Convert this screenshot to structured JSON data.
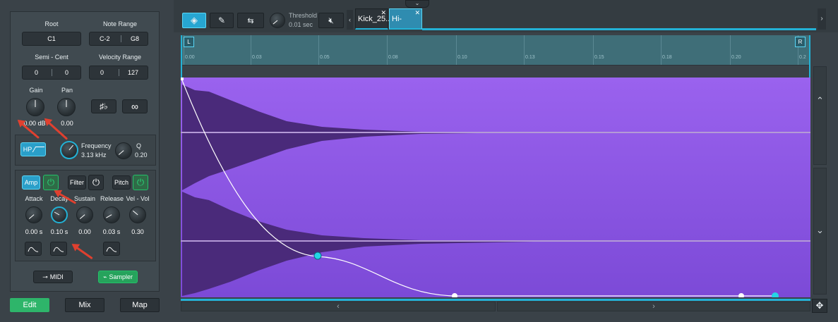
{
  "left_panel": {
    "root": {
      "label": "Root",
      "value": "C1"
    },
    "note_range": {
      "label": "Note Range",
      "low": "C-2",
      "high": "G8"
    },
    "semi_cent": {
      "label": "Semi - Cent",
      "semi": "0",
      "cent": "0"
    },
    "velocity_range": {
      "label": "Velocity Range",
      "low": "0",
      "high": "127"
    },
    "gain": {
      "label": "Gain",
      "value": "0.00 dB"
    },
    "pan": {
      "label": "Pan",
      "value": "0.00"
    },
    "filter": {
      "type_label": "HP",
      "frequency_label": "Frequency",
      "frequency_value": "3.13 kHz",
      "q_label": "Q",
      "q_value": "0.20"
    },
    "envelope": {
      "tabs": [
        {
          "label": "Amp"
        },
        {
          "label": "Filter"
        },
        {
          "label": "Pitch"
        }
      ],
      "params": [
        {
          "label": "Attack",
          "value": "0.00 s"
        },
        {
          "label": "Decay",
          "value": "0.10 s"
        },
        {
          "label": "Sustain",
          "value": "0.00"
        },
        {
          "label": "Release",
          "value": "0.03 s"
        },
        {
          "label": "Vel - Vol",
          "value": "0.30"
        }
      ]
    },
    "midi_label": "MIDI",
    "sampler_label": "Sampler"
  },
  "bottom_tabs": [
    {
      "label": "Edit"
    },
    {
      "label": "Mix"
    },
    {
      "label": "Map"
    }
  ],
  "toolbar": {
    "threshold_label": "Threshold",
    "threshold_value": "0.01 sec",
    "tabs": [
      {
        "label": "Kick_25..."
      },
      {
        "label": "Hi-Hat_..."
      }
    ]
  },
  "ruler": {
    "left_marker": "L",
    "right_marker": "R",
    "ticks": [
      "0.00",
      "0.03",
      "0.05",
      "0.08",
      "0.10",
      "0.13",
      "0.15",
      "0.18",
      "0.20",
      "0.2"
    ]
  },
  "colors": {
    "accent": "#23b2d6",
    "waveform_bg": "#9a62ee",
    "waveform": "#4a2a7a",
    "green": "#23c26a",
    "annotation": "#e0402f"
  }
}
